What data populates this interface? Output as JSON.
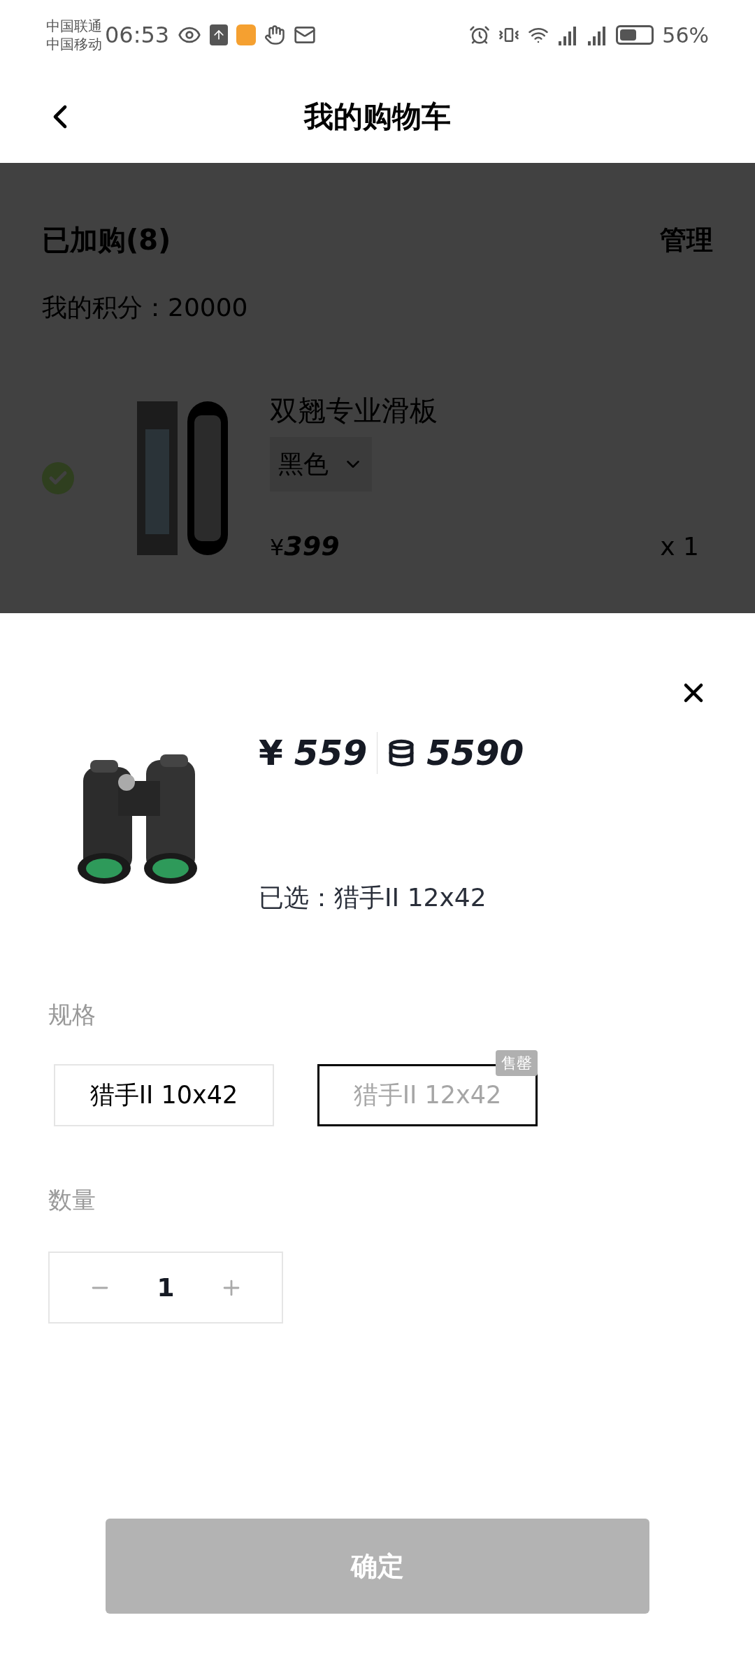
{
  "status_bar": {
    "carriers": [
      "中国联通",
      "中国移动"
    ],
    "time": "06:53",
    "battery": "56%"
  },
  "header": {
    "title": "我的购物车"
  },
  "cart": {
    "count_label": "已加购(8)",
    "manage": "管理",
    "points": "我的积分：20000",
    "items": [
      {
        "name": "双翘专业滑板",
        "variant": "黑色",
        "price_symbol": "¥",
        "price": "399",
        "quantity": "x 1",
        "selected": true
      }
    ]
  },
  "sheet": {
    "price_symbol": "¥",
    "price": "559",
    "points_price": "5590",
    "chosen": "已选：猎手II 12x42",
    "spec_label": "规格",
    "options": [
      {
        "label": "猎手II 10x42",
        "selected": false,
        "sold_out": false
      },
      {
        "label": "猎手II 12x42",
        "selected": true,
        "sold_out": true,
        "badge": "售罄"
      }
    ],
    "quantity_label": "数量",
    "quantity": "1",
    "confirm": "确定",
    "confirm_disabled": true
  }
}
